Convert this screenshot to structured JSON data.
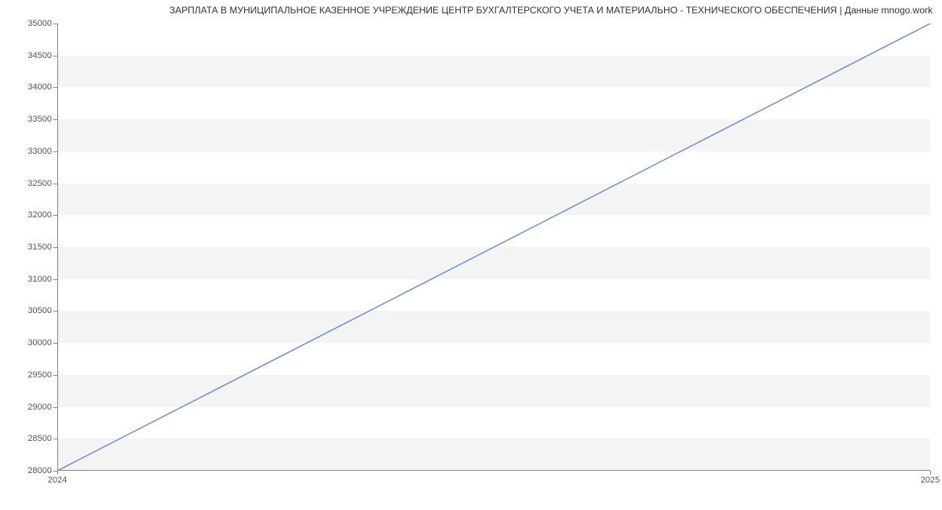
{
  "chart_data": {
    "type": "line",
    "title": "ЗАРПЛАТА В МУНИЦИПАЛЬНОЕ КАЗЕННОЕ УЧРЕЖДЕНИЕ  ЦЕНТР БУХГАЛТЕРСКОГО УЧЕТА И МАТЕРИАЛЬНО - ТЕХНИЧЕСКОГО ОБЕСПЕЧЕНИЯ | Данные mnogo.work",
    "x": [
      "2024",
      "2025"
    ],
    "values": [
      28000,
      35000
    ],
    "xlabel": "",
    "ylabel": "",
    "ylim": [
      28000,
      35000
    ],
    "y_ticks": [
      28000,
      28500,
      29000,
      29500,
      30000,
      30500,
      31000,
      31500,
      32000,
      32500,
      33000,
      33500,
      34000,
      34500,
      35000
    ],
    "line_color": "#6b8fd4"
  }
}
